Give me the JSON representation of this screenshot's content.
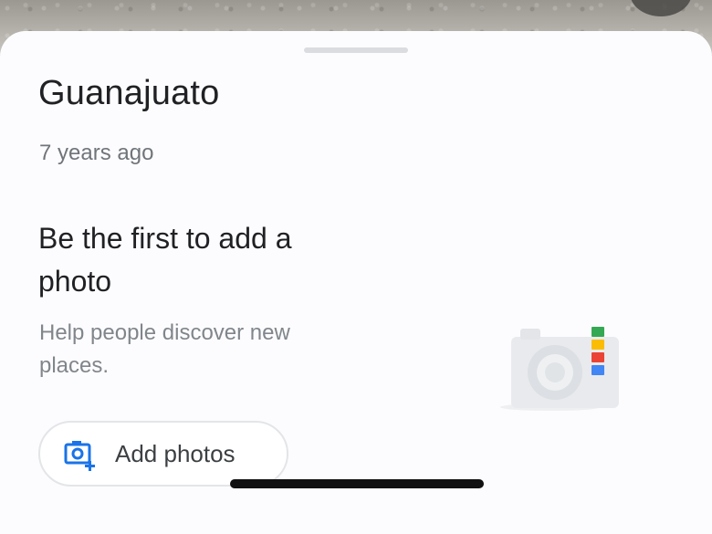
{
  "place": {
    "name": "Guanajuato",
    "timestamp": "7 years ago"
  },
  "empty_state": {
    "title": "Be the first to add a photo",
    "subtitle": "Help people discover new places.",
    "button_label": "Add photos",
    "button_icon": "add-photo-camera-icon",
    "illustration_icon": "camera-icon",
    "illustration_colors": [
      "#34a853",
      "#fbbc04",
      "#ea4335",
      "#4285f4"
    ]
  },
  "colors": {
    "accent": "#1a73e8"
  }
}
